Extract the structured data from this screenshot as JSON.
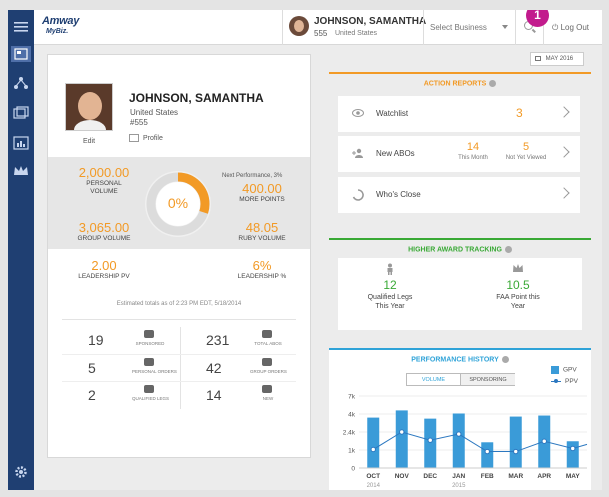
{
  "header": {
    "logo_brand": "Amway",
    "logo_sub": "MyBiz.",
    "user_name": "JOHNSON, SAMANTHA",
    "user_number": "555",
    "user_country": "United States",
    "business_select_placeholder": "Select Business",
    "logout_label": "Log Out",
    "notification_count": "1"
  },
  "month_button": "MAY 2016",
  "profile": {
    "name": "JOHNSON, SAMANTHA",
    "country": "United States",
    "number": "#555",
    "edit_label": "Edit",
    "profile_link": "Profile"
  },
  "stats": {
    "personal_volume": {
      "value": "2,000.00",
      "label_line1": "PERSONAL",
      "label_line2": "VOLUME"
    },
    "next_performance": "Next Performance, 3%",
    "more_points": {
      "value": "400.00",
      "label": "MORE POINTS"
    },
    "group_volume": {
      "value": "3,065.00",
      "label": "GROUP VOLUME"
    },
    "ruby_volume": {
      "value": "48.05",
      "label": "RUBY VOLUME"
    },
    "leadership_pv": {
      "value": "2.00",
      "label": "LEADERSHIP PV"
    },
    "leadership_pct": {
      "value": "6%",
      "label": "LEADERSHIP %"
    },
    "donut_percent": "0%",
    "donut_fill_fraction": 0.3,
    "estimate_note": "Estimated totals as of 2:23 PM EDT, 5/18/2014"
  },
  "counts": [
    {
      "value": "19",
      "label": "SPONSORED"
    },
    {
      "value": "231",
      "label": "TOTAL ABOs"
    },
    {
      "value": "5",
      "label": "PERSONAL ORDERS"
    },
    {
      "value": "42",
      "label": "GROUP ORDERS"
    },
    {
      "value": "2",
      "label": "QUALIFIED LEGS"
    },
    {
      "value": "14",
      "label": "NEW"
    }
  ],
  "action_reports": {
    "title": "ACTION REPORTS",
    "watchlist": {
      "label": "Watchlist",
      "value": "3"
    },
    "new_abos": {
      "label": "New ABOs",
      "this_month_value": "14",
      "this_month_label": "This Month",
      "not_viewed_value": "5",
      "not_viewed_label": "Not Yet Viewed"
    },
    "whos_close": {
      "label": "Who's Close"
    }
  },
  "higher_award": {
    "title": "HIGHER AWARD TRACKING",
    "qualified_legs": {
      "value": "12",
      "label_line1": "Qualified Legs",
      "label_line2": "This Year"
    },
    "faa_points": {
      "value": "10.5",
      "label_line1": "FAA Point this",
      "label_line2": "Year"
    }
  },
  "performance_history": {
    "title": "PERFORMANCE HISTORY",
    "tab_volume": "VOLUME",
    "tab_sponsoring": "SPONSORING",
    "legend_gpv": "GPV",
    "legend_ppv": "PPV"
  },
  "chart_data": {
    "type": "bar",
    "categories": [
      "OCT",
      "NOV",
      "DEC",
      "JAN",
      "FEB",
      "MAR",
      "APR",
      "MAY"
    ],
    "year_labels": [
      {
        "text": "2014",
        "under": "OCT"
      },
      {
        "text": "2015",
        "under": "JAN"
      }
    ],
    "y_ticks": [
      "7k",
      "4k",
      "2.4k",
      "1k",
      "0"
    ],
    "series": [
      {
        "name": "GPV",
        "type": "bar",
        "color": "#3a9bd8",
        "values": [
          4.9,
          5.6,
          4.8,
          5.3,
          2.5,
          5.0,
          5.1,
          2.6
        ]
      },
      {
        "name": "PPV",
        "type": "line",
        "color": "#2c78c0",
        "values": [
          1.8,
          3.5,
          2.7,
          3.3,
          1.6,
          1.6,
          2.6,
          1.9
        ]
      }
    ]
  }
}
